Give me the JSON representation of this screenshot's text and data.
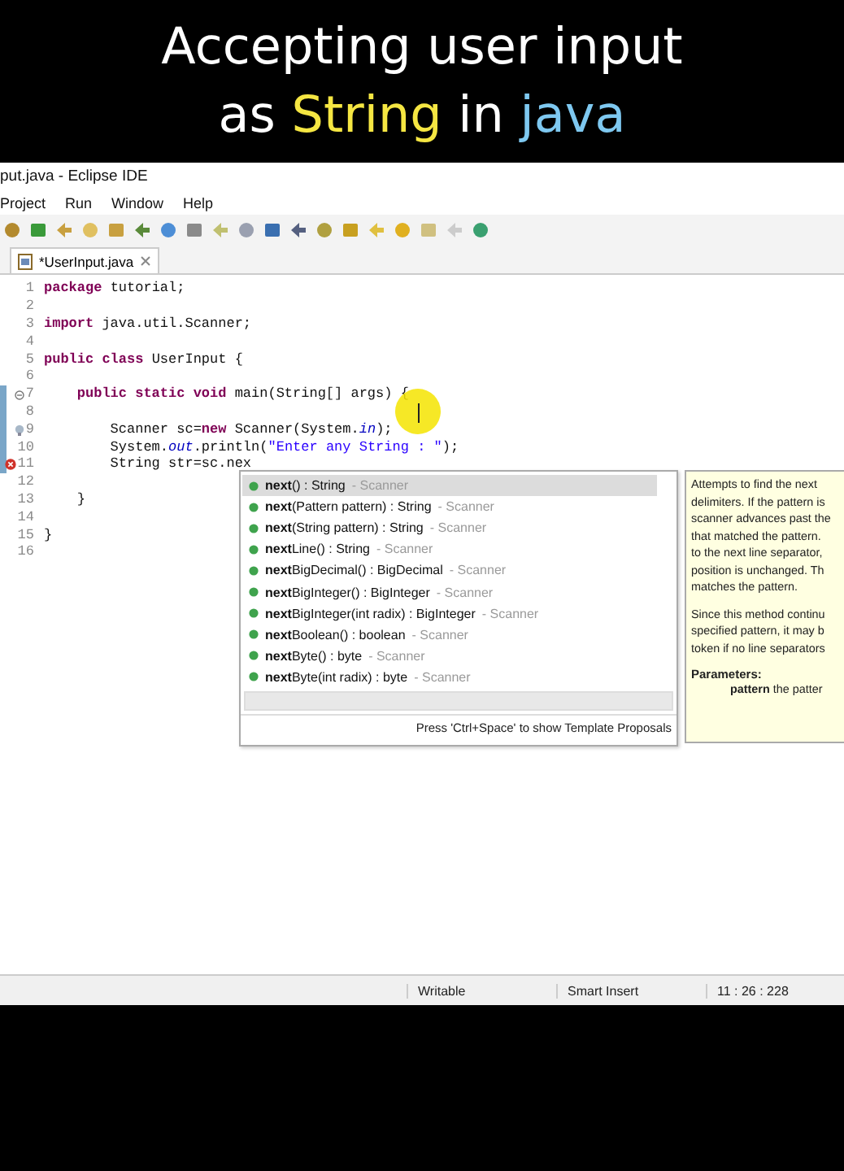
{
  "caption": {
    "lines": [
      [
        {
          "text": "Accepting user input",
          "color": "#ffffff"
        }
      ],
      [
        {
          "text": "as ",
          "color": "#ffffff"
        },
        {
          "text": "String",
          "color": "#f5e642"
        },
        {
          "text": " in ",
          "color": "#ffffff"
        },
        {
          "text": "java",
          "color": "#7ec8f0"
        }
      ]
    ]
  },
  "window": {
    "title": "put.java - Eclipse IDE"
  },
  "menu": [
    "Project",
    "Run",
    "Window",
    "Help"
  ],
  "editor_tab": {
    "label": "*UserInput.java",
    "selected": true
  },
  "code": [
    {
      "number": "1",
      "kind": "plain",
      "tokens": [
        {
          "kind": "kw",
          "text": "package"
        },
        {
          "kind": "plain",
          "text": " tutorial;"
        }
      ]
    },
    {
      "number": "2",
      "kind": "plain"
    },
    {
      "number": "3",
      "kind": "plain",
      "tokens": [
        {
          "kind": "kw",
          "text": "import"
        },
        {
          "kind": "plain",
          "text": " java.util.Scanner;"
        }
      ]
    },
    {
      "number": "4",
      "kind": "plain"
    },
    {
      "number": "5",
      "kind": "plain",
      "tokens": [
        {
          "kind": "kw",
          "text": "public class"
        },
        {
          "kind": "plain",
          "text": " UserInput {"
        }
      ]
    },
    {
      "number": "6",
      "kind": "plain"
    },
    {
      "number": "7",
      "kind": "fold",
      "tokens": [
        {
          "kind": "kw",
          "text": "    public static void"
        },
        {
          "kind": "plain",
          "text": " main(String[] args) {"
        }
      ]
    },
    {
      "number": "8",
      "kind": "plain"
    },
    {
      "number": "9",
      "kind": "warning",
      "tokens": [
        {
          "kind": "plain",
          "text": "        Scanner sc="
        },
        {
          "kind": "kw",
          "text": "new"
        },
        {
          "kind": "plain",
          "text": " Scanner(System."
        },
        {
          "kind": "field",
          "text": "in"
        },
        {
          "kind": "plain",
          "text": ");"
        }
      ]
    },
    {
      "number": "10",
      "kind": "plain",
      "tokens": [
        {
          "kind": "plain",
          "text": "        System."
        },
        {
          "kind": "field",
          "text": "out"
        },
        {
          "kind": "plain",
          "text": ".println("
        },
        {
          "kind": "str",
          "text": "\"Enter any String : \""
        },
        {
          "kind": "plain",
          "text": ");"
        }
      ]
    },
    {
      "number": "11",
      "kind": "error",
      "tokens": [
        {
          "kind": "plain",
          "text": "        String str=sc.nex"
        }
      ]
    },
    {
      "number": "12",
      "kind": "plain"
    },
    {
      "number": "13",
      "kind": "plain",
      "tokens": [
        {
          "kind": "plain",
          "text": "    }"
        }
      ]
    },
    {
      "number": "14",
      "kind": "plain"
    },
    {
      "number": "15",
      "kind": "plain",
      "tokens": [
        {
          "kind": "plain",
          "text": "}"
        }
      ]
    },
    {
      "number": "16",
      "kind": "plain"
    }
  ],
  "completions": [
    {
      "label": "**next**() : String",
      "owner": "- Scanner",
      "selected": true
    },
    {
      "label": "**next**(Pattern pattern) : String",
      "owner": "- Scanner",
      "selected": false
    },
    {
      "label": "**next**(String pattern) : String",
      "owner": "- Scanner",
      "selected": false
    },
    {
      "label": "**next**Line() : String",
      "owner": "- Scanner",
      "selected": false
    },
    {
      "label": "**next**BigDecimal() : BigDecimal",
      "owner": "- Scanner",
      "selected": false
    },
    {
      "label": "**next**BigInteger() : BigInteger",
      "owner": "- Scanner",
      "selected": false
    },
    {
      "label": "**next**BigInteger(int radix) : BigInteger",
      "owner": "- Scanner",
      "selected": false
    },
    {
      "label": "**next**Boolean() : boolean",
      "owner": "- Scanner",
      "selected": false
    },
    {
      "label": "**next**Byte() : byte",
      "owner": "- Scanner",
      "selected": false
    },
    {
      "label": "**next**Byte(int radix) : byte",
      "owner": "- Scanner",
      "selected": false
    }
  ],
  "completion_hint": "Press 'Ctrl+Space' to show Template Proposals",
  "doc": {
    "paragraphs": [
      [
        "Attempts to find the next",
        "delimiters. If the pattern is",
        "scanner advances past the",
        "that matched the pattern.",
        "to the next line separator,",
        "position is unchanged. Th",
        "matches the pattern."
      ],
      [
        "Since this method continu",
        "specified pattern, it may b",
        "token if no line separators"
      ]
    ],
    "parameters_heading": "Parameters:",
    "parameter_name": "pattern",
    "parameter_text": "the patter"
  },
  "status_bar": [
    "Writable",
    "Smart Insert",
    "11 : 26 : 228"
  ]
}
